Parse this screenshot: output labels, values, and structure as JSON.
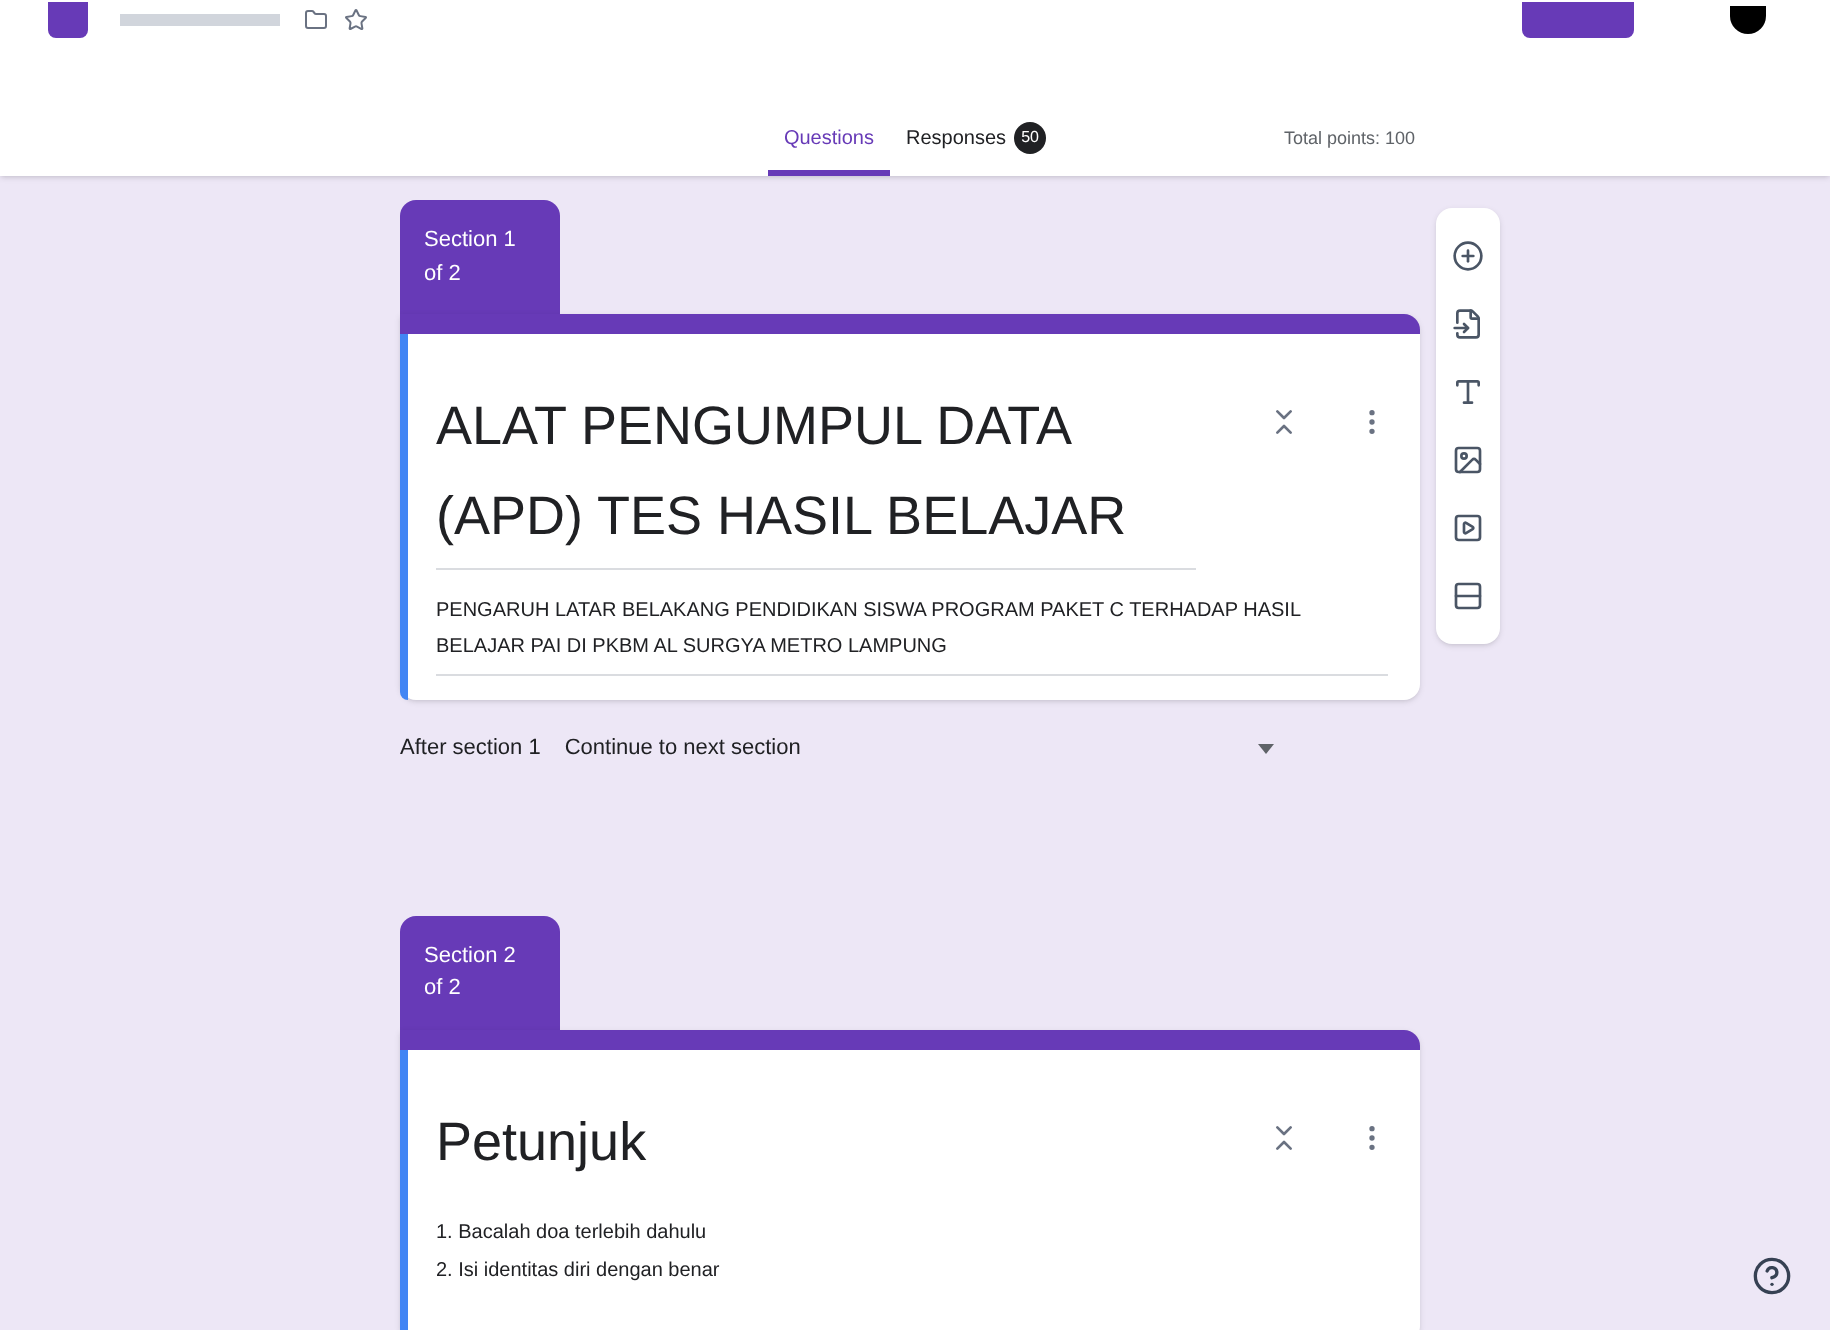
{
  "tabs": [
    {
      "label": "Questions",
      "selected": true
    },
    {
      "label": "Responses",
      "selected": false,
      "count": "50"
    }
  ],
  "total_points": "Total points: 100",
  "sections": [
    {
      "badge": "Section 1 of 2",
      "title": "ALAT PENGUMPUL DATA (APD) TES HASIL BELAJAR",
      "description": "PENGARUH LATAR BELAKANG PENDIDIKAN SISWA PROGRAM PAKET C TERHADAP HASIL BELAJAR PAI DI PKBM AL SURGYA METRO LAMPUNG",
      "after_label": "After section 1",
      "after_value": "Continue to next section"
    },
    {
      "badge": "Section 2 of 2",
      "title": "Petunjuk",
      "list": [
        "1.  Bacalah doa terlebih dahulu",
        "2.  Isi identitas diri dengan benar"
      ]
    }
  ]
}
